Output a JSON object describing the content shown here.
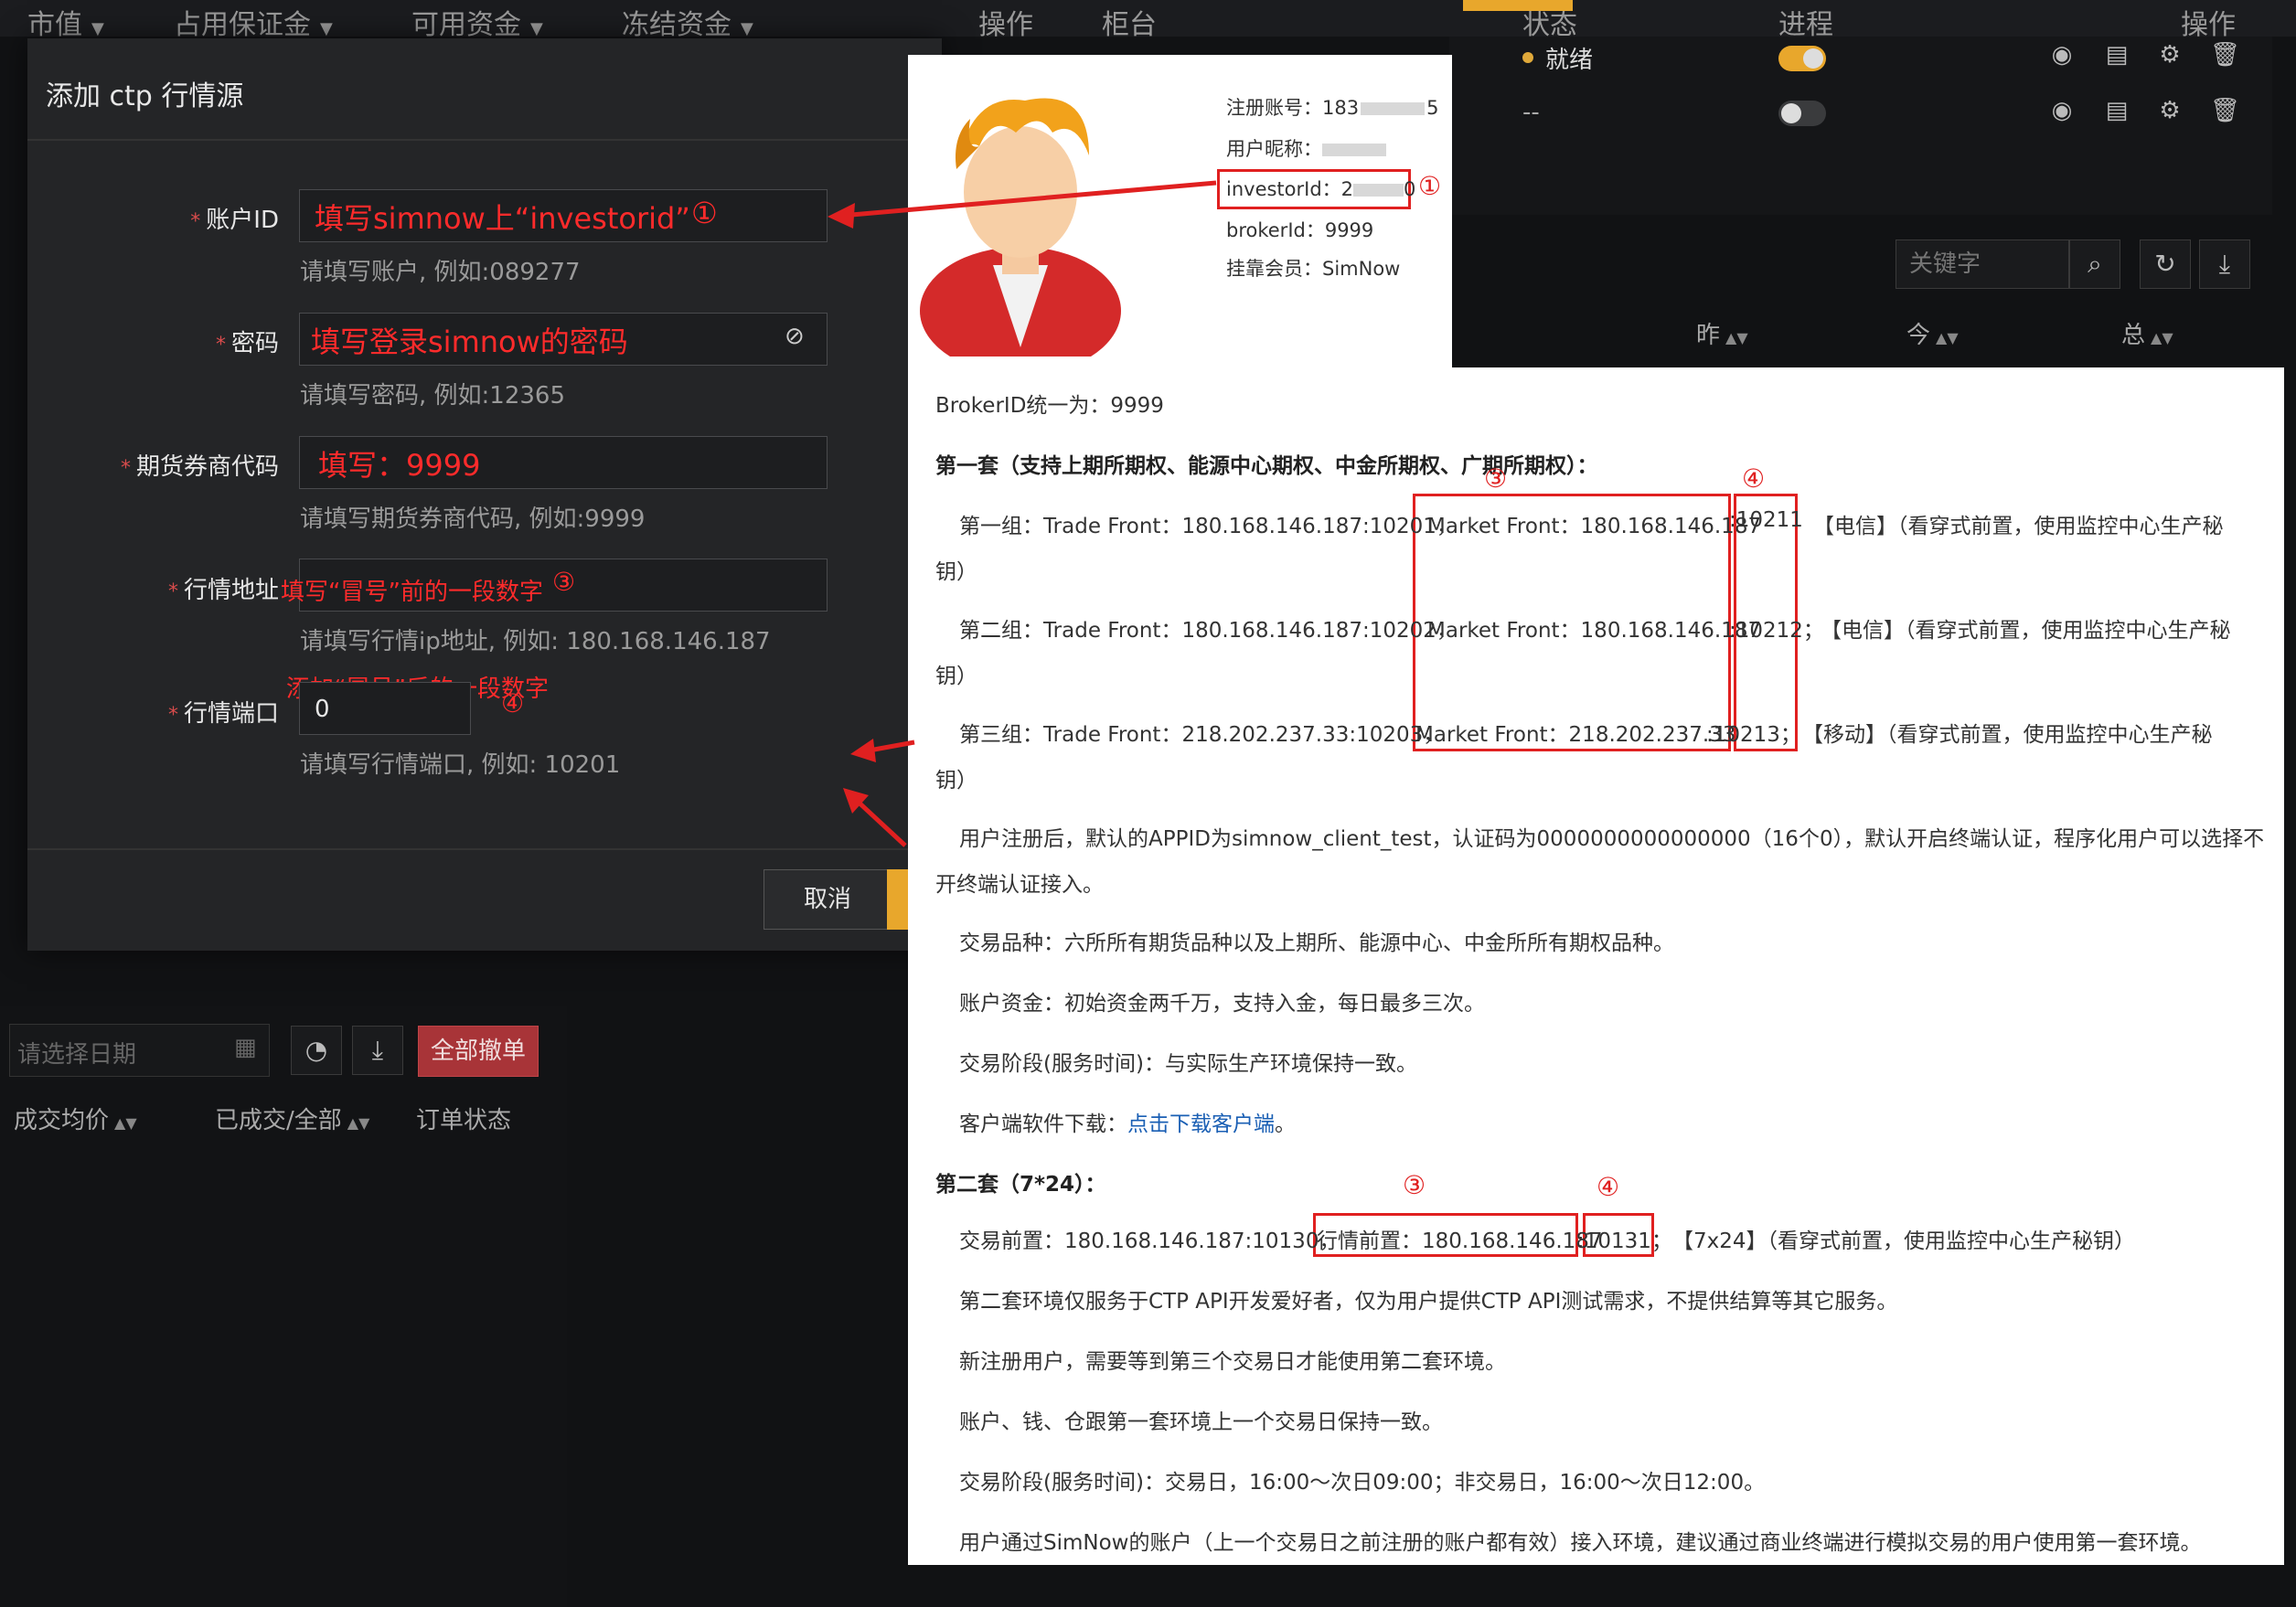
{
  "background_table": {
    "headers": [
      "市值",
      "占用保证金",
      "可用资金",
      "冻结资金",
      "操作",
      "柜台",
      "状态",
      "进程",
      "操作"
    ],
    "rows": [
      {
        "status": "就绪"
      },
      {
        "status": "--"
      }
    ],
    "search_placeholder": "关键字",
    "cols_right": [
      "昨",
      "今",
      "总"
    ],
    "date_placeholder": "请选择日期",
    "cancel_all": "全部撤单",
    "cols_left": [
      "成交均价",
      "已成交/全部",
      "订单状态"
    ]
  },
  "dialog": {
    "title": "添加 ctp 行情源",
    "fields": [
      {
        "label": "账户ID",
        "value": "",
        "annotation": "填写simnow上“investorid”",
        "annotation_num": "①",
        "hint": "请填写账户, 例如:089277"
      },
      {
        "label": "密码",
        "value": "",
        "annotation": "填写登录simnow的密码",
        "hint": "请填写密码, 例如:12365"
      },
      {
        "label": "期货券商代码",
        "value": "",
        "annotation": "填写：9999",
        "hint": "请填写期货券商代码, 例如:9999"
      },
      {
        "label": "行情地址",
        "value": "",
        "annotation": "填写“冒号”前的一段数字",
        "annotation_num": "③",
        "hint": "请填写行情ip地址, 例如: 180.168.146.187"
      },
      {
        "label": "行情端口",
        "value": "0",
        "annotation": "添加“冒号”后的一段数字",
        "annotation_num": "④",
        "hint": "请填写行情端口, 例如: 10201"
      }
    ],
    "cancel_label": "取消"
  },
  "profile": {
    "reg_account": "注册账号：183",
    "reg_account_tail": "5",
    "nickname": "用户昵称：",
    "investor_id": "investorId：2",
    "investor_id_tail": "0",
    "investor_num": "①",
    "broker_id": "brokerId：9999",
    "member": "挂靠会员：SimNow"
  },
  "doc": {
    "line_broker": "BrokerID统一为：9999",
    "set1_title": "第一套（支持上期所期权、能源中心期权、中金所期权、广期所期权）：",
    "group1_trade": "第一组：Trade Front：180.168.146.187:10201，",
    "group1_market": "Market Front：180.168.146.187",
    "group1_port": ":10211",
    "group1_tail": "【电信】（看穿式前置，使用监控中心生产秘",
    "group1_wrap": "钥）",
    "group2_trade": "第二组：Trade Front：180.168.146.187:10202，",
    "group2_market": "Market Front：180.168.146.187",
    "group2_port": ":10212；",
    "group2_tail": "【电信】（看穿式前置，使用监控中心生产秘",
    "group2_wrap": "钥）",
    "group3_trade": "第三组：Trade Front：218.202.237.33:10203，",
    "group3_market": "Market Front：218.202.237.33",
    "group3_port": ":10213；",
    "group3_tail": "【移动】（看穿式前置，使用监控中心生产秘",
    "group3_wrap": "钥）",
    "para_appid": "用户注册后，默认的APPID为simnow_client_test，认证码为0000000000000000（16个0），默认开启终端认证，程序化用户可以选择不",
    "para_appid_wrap": "开终端认证接入。",
    "para_varieties": "交易品种：六所所有期货品种以及上期所、能源中心、中金所所有期权品种。",
    "para_funds": "账户资金：初始资金两千万，支持入金，每日最多三次。",
    "para_hours1": "交易阶段(服务时间)：与实际生产环境保持一致。",
    "para_download_prefix": "客户端软件下载：",
    "para_download_link": "点击下载客户端",
    "para_download_suffix": "。",
    "set2_title": "第二套（7*24）：",
    "set2_trade": "交易前置：180.168.146.187:10130，",
    "set2_market": "行情前置：180.168.146.187",
    "set2_port": ":10131；",
    "set2_tail": "【7x24】（看穿式前置，使用监控中心生产秘钥）",
    "para_set2_1": "第二套环境仅服务于CTP API开发爱好者，仅为用户提供CTP API测试需求，不提供结算等其它服务。",
    "para_set2_2": "新注册用户，需要等到第三个交易日才能使用第二套环境。",
    "para_set2_3": "账户、钱、仓跟第一套环境上一个交易日保持一致。",
    "para_set2_4": "交易阶段(服务时间)：交易日，16:00～次日09:00；非交易日，16:00～次日12:00。",
    "para_set2_5": "用户通过SimNow的账户（上一个交易日之前注册的账户都有效）接入环境，建议通过商业终端进行模拟交易的用户使用第一套环境。",
    "num3": "③",
    "num4": "④"
  },
  "colors": {
    "accent": "#e8a72c",
    "annotation_red": "#ff2b2b",
    "danger": "#a83438"
  }
}
